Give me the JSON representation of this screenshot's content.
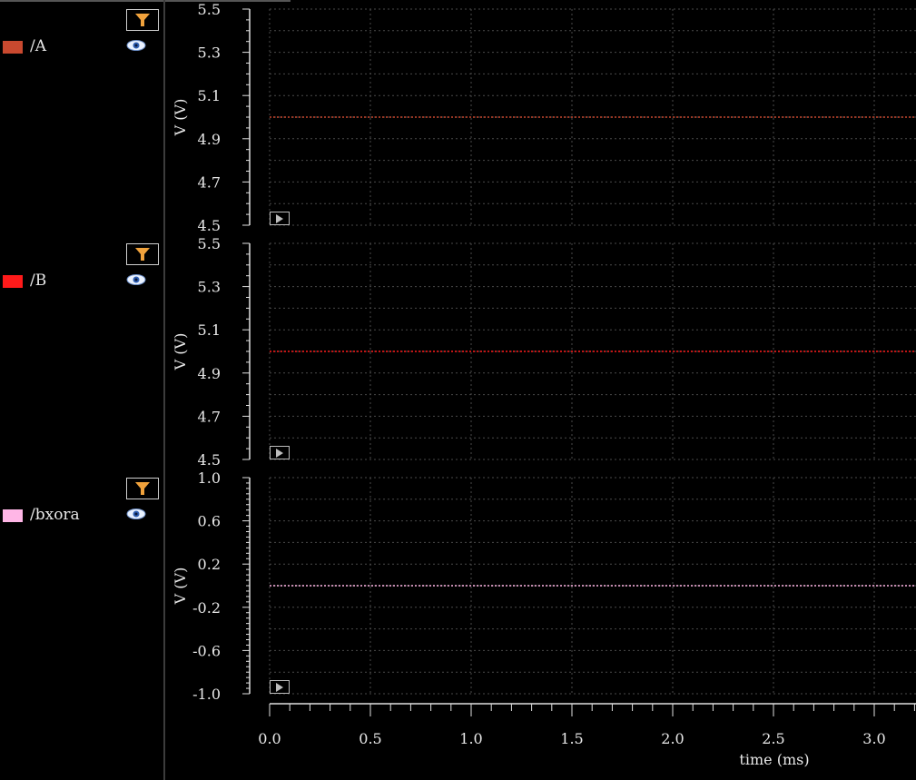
{
  "legend": [
    {
      "name": "/A",
      "color": "#c9492f",
      "filter_icon": "filter-icon",
      "visibility_icon": "eye-icon"
    },
    {
      "name": "/B",
      "color": "#ff1a1a",
      "filter_icon": "filter-icon",
      "visibility_icon": "eye-icon"
    },
    {
      "name": "/bxora",
      "color": "#ffb6e6",
      "filter_icon": "filter-icon",
      "visibility_icon": "eye-icon"
    }
  ],
  "controls": {
    "play_icon": "play-icon"
  },
  "chart_data": [
    {
      "type": "line",
      "ylabel": "V (V)",
      "ylim": [
        4.5,
        5.5
      ],
      "yticks": [
        "5.5",
        "5.3",
        "5.1",
        "4.9",
        "4.7",
        "4.5"
      ],
      "series": [
        {
          "name": "/A",
          "color": "#c9492f",
          "x": [
            0.0,
            3.2
          ],
          "y": [
            5.0,
            5.0
          ]
        }
      ],
      "grid": true
    },
    {
      "type": "line",
      "ylabel": "V (V)",
      "ylim": [
        4.5,
        5.5
      ],
      "yticks": [
        "5.5",
        "5.3",
        "5.1",
        "4.9",
        "4.7",
        "4.5"
      ],
      "series": [
        {
          "name": "/B",
          "color": "#ff1a1a",
          "x": [
            0.0,
            3.2
          ],
          "y": [
            5.0,
            5.0
          ]
        }
      ],
      "grid": true
    },
    {
      "type": "line",
      "ylabel": "V (V)",
      "ylim": [
        -1.0,
        1.0
      ],
      "yticks": [
        "1.0",
        "0.6",
        "0.2",
        "-0.2",
        "-0.6",
        "-1.0"
      ],
      "series": [
        {
          "name": "/bxora",
          "color": "#ffb6e6",
          "x": [
            0.0,
            3.2
          ],
          "y": [
            0.0,
            0.0
          ]
        }
      ],
      "grid": true
    }
  ],
  "x_axis": {
    "label": "time (ms)",
    "xlim": [
      0.0,
      3.2
    ],
    "ticks": [
      "0.0",
      "0.5",
      "1.0",
      "1.5",
      "2.0",
      "2.5",
      "3.0"
    ]
  }
}
